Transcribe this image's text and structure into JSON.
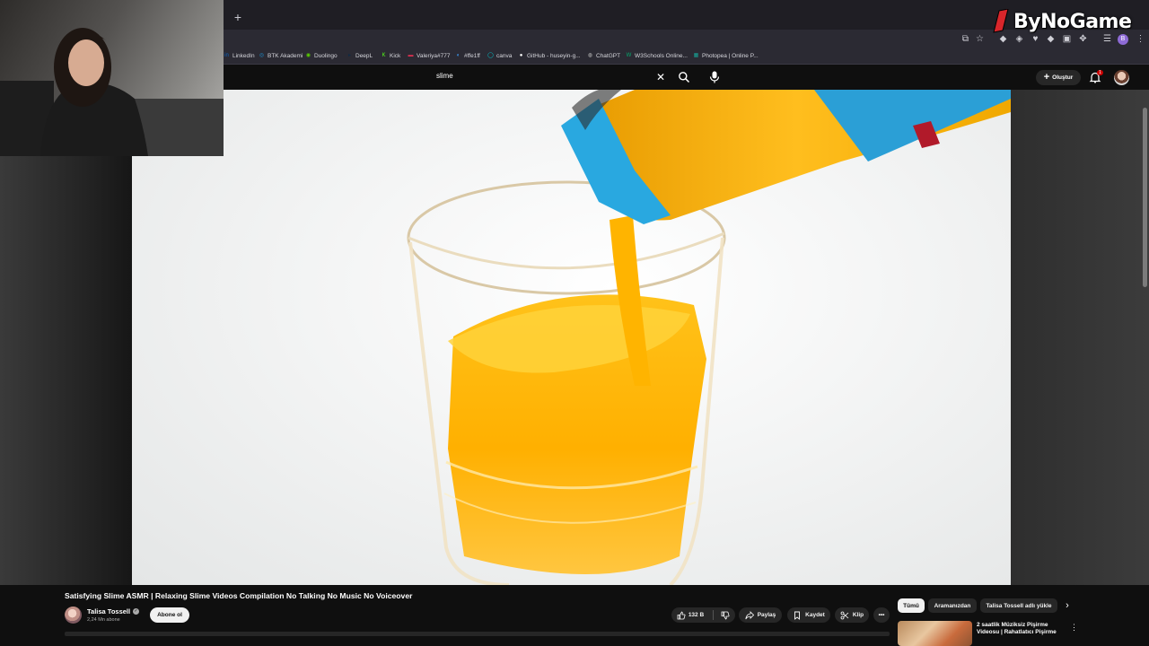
{
  "bookmarks": [
    {
      "label": "LinkedIn",
      "icon": "linkedin-icon",
      "color": "#0a66c2"
    },
    {
      "label": "BTK Akademi",
      "icon": "btk-icon",
      "color": "#1d8fd1"
    },
    {
      "label": "Duolingo",
      "icon": "duolingo-icon",
      "color": "#58cc02"
    },
    {
      "label": "DeepL",
      "icon": "deepl-icon",
      "color": "#0f2b46"
    },
    {
      "label": "Kick",
      "icon": "kick-icon",
      "color": "#53fc18"
    },
    {
      "label": "Valeriya#777",
      "icon": "valeriya-icon",
      "color": "#d9304f"
    },
    {
      "label": "#ffe1ff",
      "icon": "color-icon",
      "color": "#3aa0ff"
    },
    {
      "label": "canva",
      "icon": "canva-icon",
      "color": "#00c4cc"
    },
    {
      "label": "GitHub - huseyin-g...",
      "icon": "github-icon",
      "color": "#ffffff"
    },
    {
      "label": "ChatGPT",
      "icon": "chatgpt-icon",
      "color": "#bbbbbb"
    },
    {
      "label": "W3Schools Online...",
      "icon": "w3schools-icon",
      "color": "#04aa6d"
    },
    {
      "label": "Photopea | Online P...",
      "icon": "photopea-icon",
      "color": "#18a497"
    }
  ],
  "profile_initial": "B",
  "logo": {
    "text": "ByNoGame",
    "accent": "#d8262b"
  },
  "header": {
    "search_value": "slime",
    "clear_icon": "close-icon",
    "create_label": "Oluştur",
    "notification_count": "1"
  },
  "video": {
    "title": "Satisfying Slime ASMR | Relaxing Slime Videos Compilation No Talking No Music No Voiceover",
    "channel_name": "Talisa Tossell",
    "subscribers": "2,24 Mn abone",
    "subscribe_label": "Abone ol",
    "likes": "132 B",
    "share_label": "Paylaş",
    "save_label": "Kaydet",
    "clip_label": "Klip",
    "more_label": "•••"
  },
  "chips": [
    "Tümü",
    "Aramanızdan",
    "Talisa Tossell adlı yükle"
  ],
  "recommendation": {
    "title": "2 saatlik Müziksiz Pişirme Videosu | Rahatlatıcı Pişirme"
  },
  "colors": {
    "bg": "#0f0f0f",
    "juice": "#ffb400",
    "bottle_cap": "#29a8e0"
  }
}
